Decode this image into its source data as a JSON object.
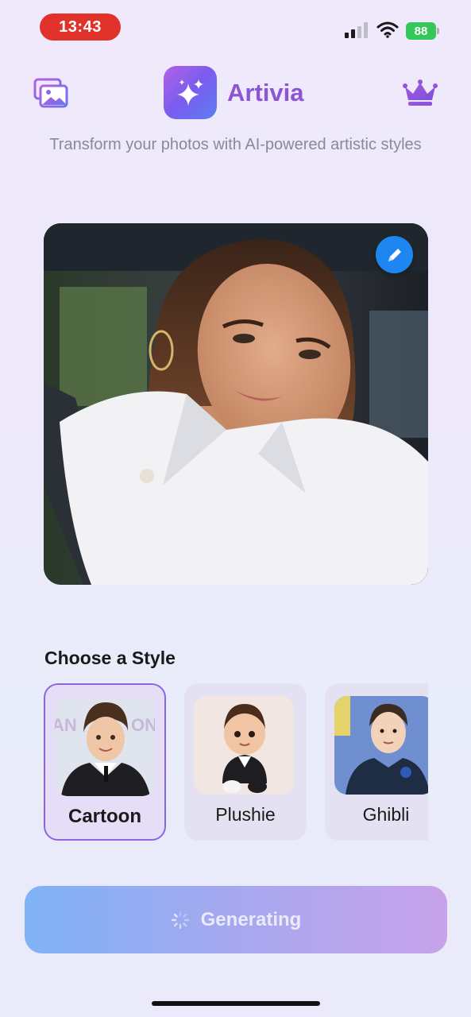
{
  "status_bar": {
    "time": "13:43",
    "battery": "88"
  },
  "header": {
    "app_name": "Artivia",
    "subtitle": "Transform your photos with AI-powered artistic styles",
    "icons": [
      "gallery-icon",
      "sparkles-icon",
      "crown-icon"
    ]
  },
  "photo": {
    "edit_icon": "pencil-icon"
  },
  "styles": {
    "section_title": "Choose a Style",
    "items": [
      {
        "label": "Cartoon",
        "selected": true
      },
      {
        "label": "Plushie",
        "selected": false
      },
      {
        "label": "Ghibli",
        "selected": false
      }
    ]
  },
  "generate": {
    "label": "Generating",
    "state": "loading"
  },
  "colors": {
    "accent_purple": "#8b55d6",
    "edit_blue": "#1d86f0",
    "time_pill_red": "#e0312b",
    "battery_green": "#34c759"
  }
}
